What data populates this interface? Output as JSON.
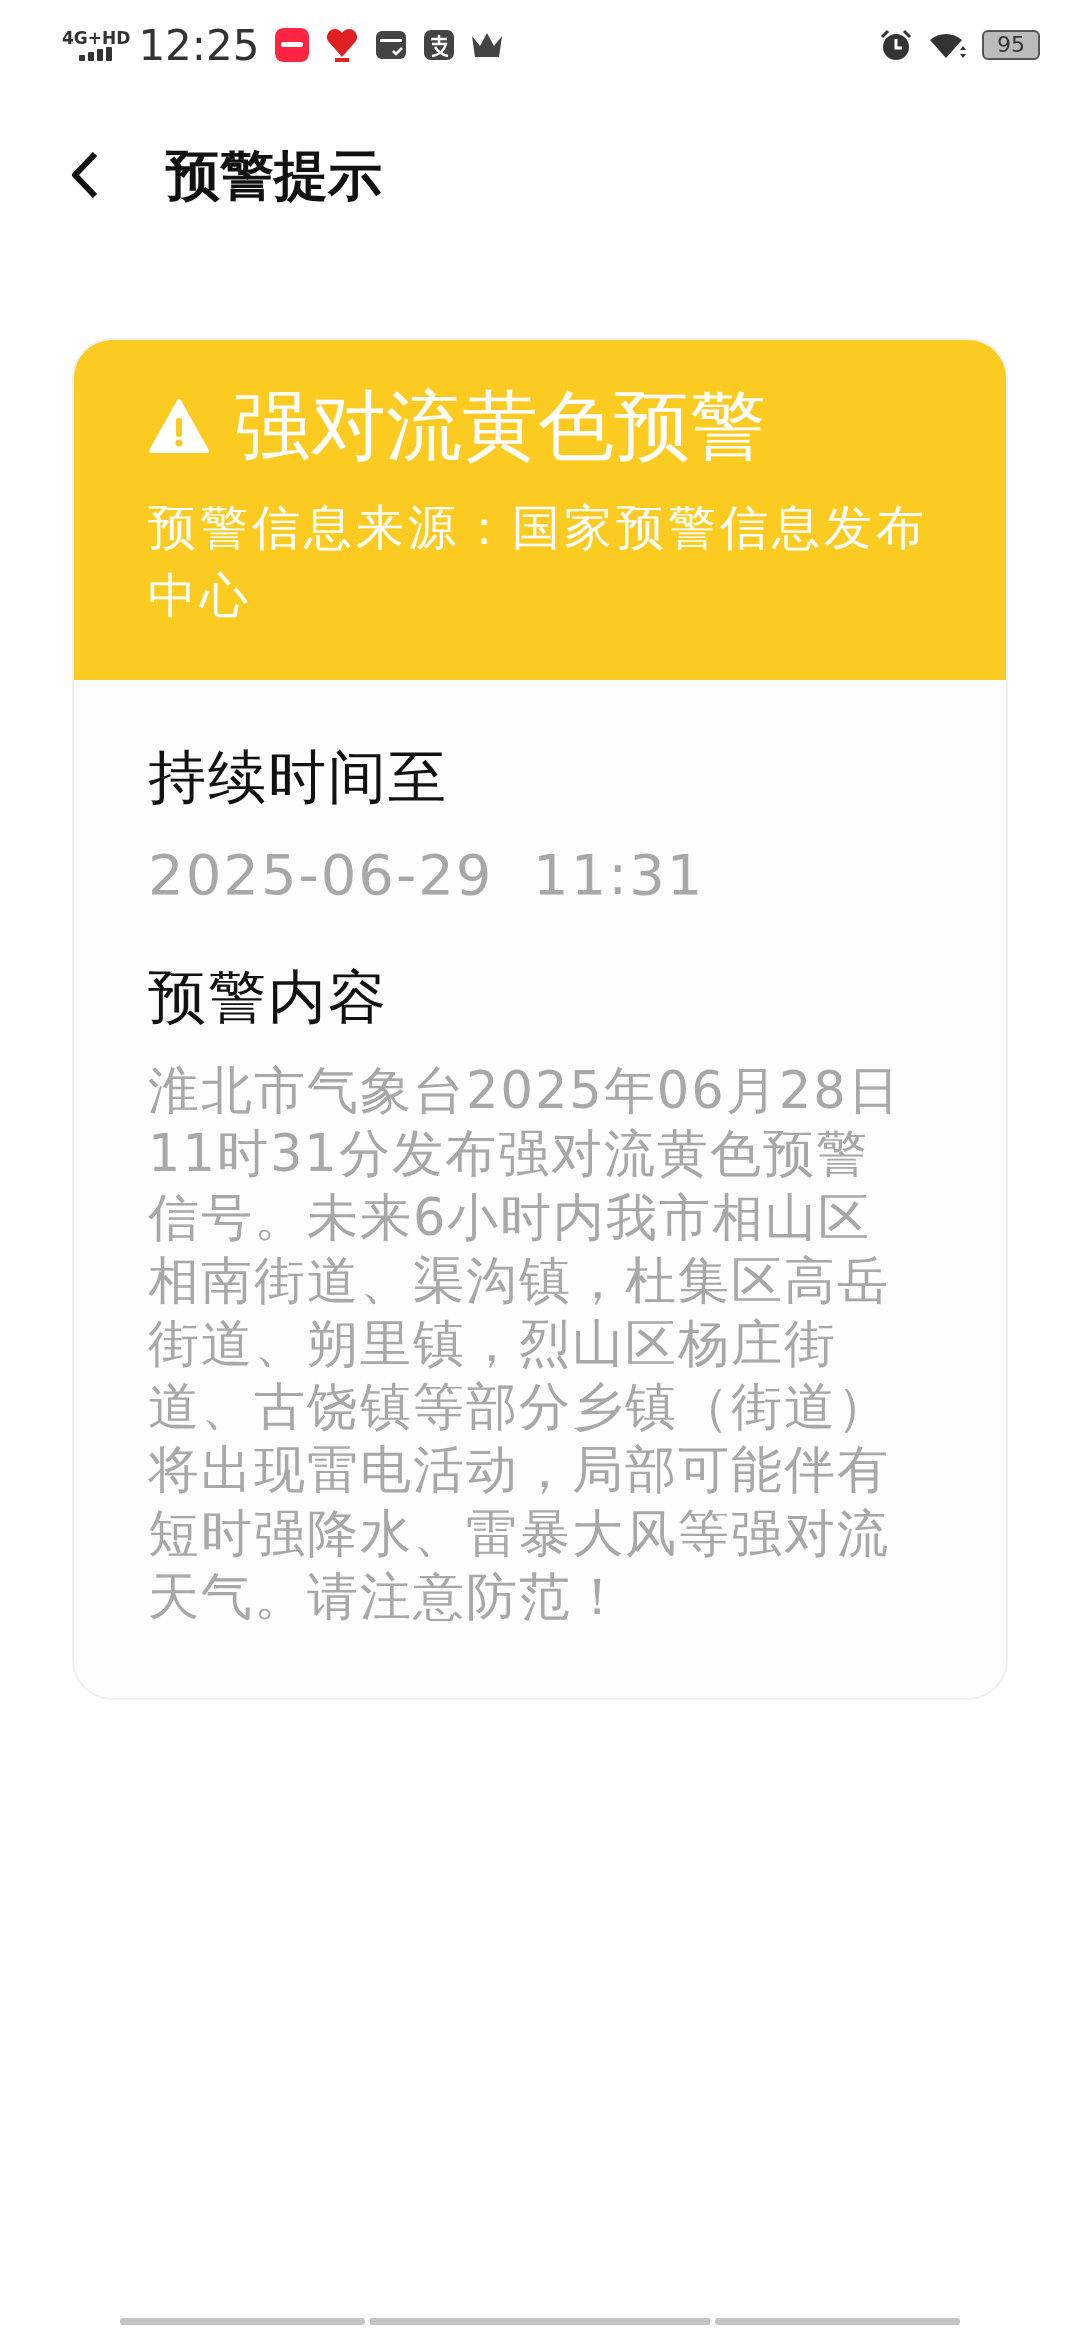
{
  "status_bar": {
    "network": "4G+HD",
    "time": "12:25",
    "battery": "95"
  },
  "header": {
    "title": "预警提示"
  },
  "alert": {
    "color": "#fccb21",
    "title": "强对流黄色预警",
    "source": "预警信息来源：国家预警信息发布中心",
    "sections": [
      {
        "heading": "持续时间至",
        "text": "2025-06-29  11:31"
      },
      {
        "heading": "预警内容",
        "text": "淮北市气象台2025年06月28日11时31分发布强对流黄色预警信号。未来6小时内我市相山区相南街道、渠沟镇，杜集区高岳街道、朔里镇，烈山区杨庄街道、古饶镇等部分乡镇（街道）将出现雷电活动，局部可能伴有短时强降水、雷暴大风等强对流天气。请注意防范！"
      }
    ]
  }
}
